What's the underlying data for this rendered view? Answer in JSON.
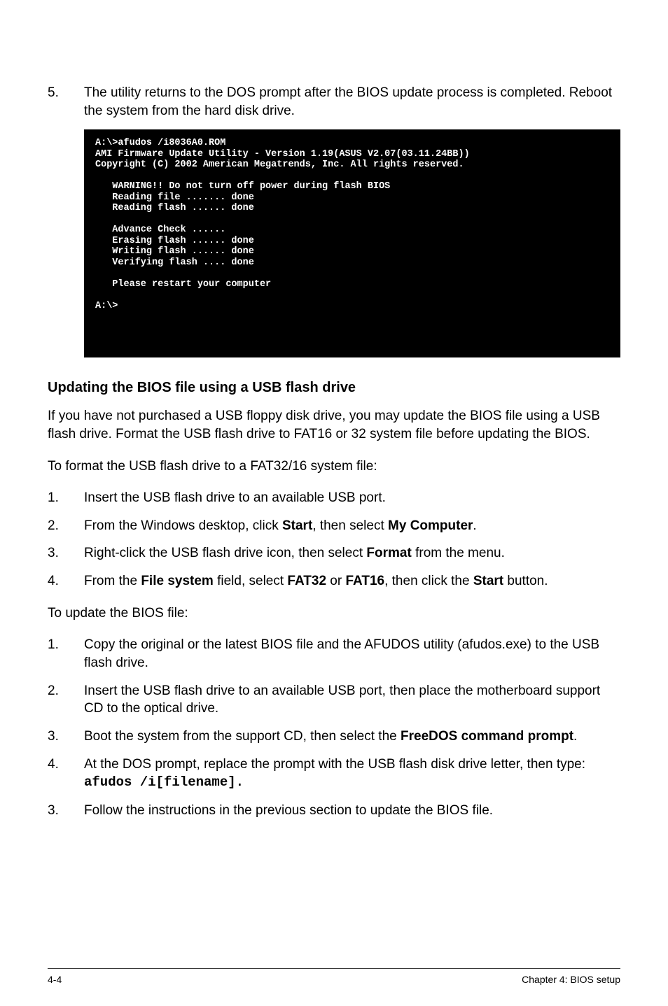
{
  "step5": {
    "num": "5.",
    "txt": "The utility returns to the DOS prompt after the BIOS update process is completed. Reboot the system from the hard disk drive."
  },
  "terminal": "A:\\>afudos /i8036A0.ROM\nAMI Firmware Update Utility - Version 1.19(ASUS V2.07(03.11.24BB))\nCopyright (C) 2002 American Megatrends, Inc. All rights reserved.\n\n   WARNING!! Do not turn off power during flash BIOS\n   Reading file ....... done\n   Reading flash ...... done\n\n   Advance Check ......\n   Erasing flash ...... done\n   Writing flash ...... done\n   Verifying flash .... done\n\n   Please restart your computer\n\nA:\\>",
  "heading": "Updating the BIOS file using a USB flash drive",
  "intro": "If you have not purchased a USB floppy disk drive, you may  update the BIOS file using a USB flash drive. Format the USB flash drive to FAT16 or 32 system file before updating the BIOS.",
  "formatLead": "To format the USB flash drive to a FAT32/16 system file:",
  "formatSteps": [
    {
      "num": "1.",
      "pre": "Insert the USB flash drive to an available USB port.",
      "bold1": "",
      "mid": "",
      "bold2": "",
      "post": ""
    },
    {
      "num": "2.",
      "pre": "From the Windows desktop, click ",
      "bold1": "Start",
      "mid": ", then select ",
      "bold2": "My Computer",
      "post": "."
    },
    {
      "num": "3.",
      "pre": "Right-click the USB flash drive icon, then select ",
      "bold1": "Format",
      "mid": " from the menu.",
      "bold2": "",
      "post": ""
    },
    {
      "num": "4.",
      "pre": "From the ",
      "bold1": "File system",
      "mid": " field, select ",
      "bold2": "FAT32",
      "post_mid": " or ",
      "bold3": "FAT16",
      "post2": ", then click the ",
      "bold4": "Start",
      "post3": " button."
    }
  ],
  "updateLead": "To update the BIOS file:",
  "updateSteps": [
    {
      "num": "1.",
      "txt": "Copy the original or the latest BIOS file and the AFUDOS utility  (afudos.exe) to the USB flash drive."
    },
    {
      "num": "2.",
      "txt": "Insert the USB flash drive to an available USB port, then place the motherboard support CD to the optical drive."
    },
    {
      "num": "3.",
      "pre": "Boot the system from the support CD, then select the ",
      "bold": "FreeDOS command prompt",
      "post": "."
    },
    {
      "num": "4.",
      "pre": "At the DOS prompt, replace the prompt with the USB flash disk drive letter, then type: ",
      "mono": "afudos /i[filename].",
      "post": ""
    },
    {
      "num": "3.",
      "txt": "Follow the instructions in the previous section to update the BIOS file."
    }
  ],
  "footer": {
    "left": "4-4",
    "right": "Chapter 4: BIOS setup"
  }
}
